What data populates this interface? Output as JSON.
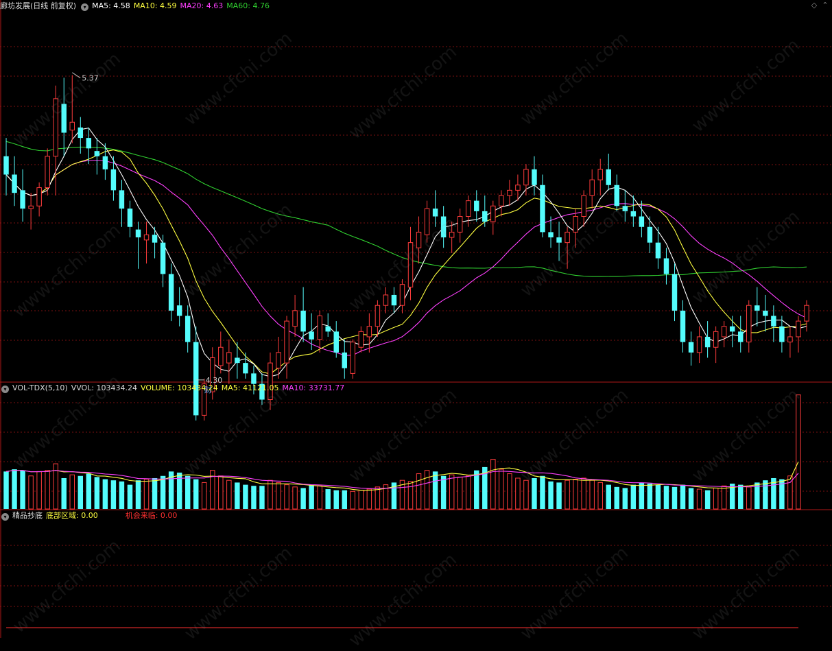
{
  "header_main": {
    "title": "廊坊发展(日线 前复权)",
    "ma5": "MA5: 4.58",
    "ma10": "MA10: 4.59",
    "ma20": "MA20: 4.63",
    "ma60": "MA60: 4.76"
  },
  "header_vol": {
    "name": "VOL-TDX(5,10)",
    "vvol": "VVOL: 103434.24",
    "volume": "VOLUME: 103434.24",
    "ma5": "MA5: 41121.05",
    "ma10": "MA10: 33731.77"
  },
  "header_ind": {
    "name": "精品抄底",
    "bottom": "底部区域: 0.00",
    "chance": "机会来临: 0.00"
  },
  "annotations": {
    "high": "5.37",
    "low": "4.30",
    "fin": "财"
  },
  "watermark": "www.cfchi.com",
  "colors": {
    "up": "#ff3c3c",
    "down": "#54fcfc",
    "ma5": "#ffffff",
    "ma10": "#ffff40",
    "ma20": "#ff40ff",
    "ma60": "#30d030",
    "grid": "#7a1010",
    "divider": "#b01818"
  },
  "chart_data": [
    {
      "type": "candlestick",
      "title": "廊坊发展(日线 前复权)",
      "ylim": [
        4.2,
        5.6
      ],
      "high_marker": 5.37,
      "low_marker": 4.3,
      "ohlc": [
        [
          5.05,
          5.12,
          4.9,
          4.98
        ],
        [
          4.98,
          5.05,
          4.86,
          4.91
        ],
        [
          4.92,
          5.0,
          4.8,
          4.85
        ],
        [
          4.85,
          4.91,
          4.77,
          4.86
        ],
        [
          4.86,
          4.95,
          4.82,
          4.93
        ],
        [
          4.93,
          5.08,
          4.9,
          5.05
        ],
        [
          5.05,
          5.32,
          4.9,
          5.27
        ],
        [
          5.25,
          5.35,
          5.05,
          5.14
        ],
        [
          5.15,
          5.36,
          5.1,
          5.18
        ],
        [
          5.16,
          5.2,
          5.06,
          5.12
        ],
        [
          5.12,
          5.16,
          5.02,
          5.08
        ],
        [
          5.07,
          5.12,
          4.98,
          5.05
        ],
        [
          5.05,
          5.1,
          4.96,
          5.0
        ],
        [
          5.0,
          5.05,
          4.88,
          4.92
        ],
        [
          4.92,
          4.96,
          4.78,
          4.85
        ],
        [
          4.85,
          4.88,
          4.74,
          4.78
        ],
        [
          4.77,
          4.8,
          4.62,
          4.74
        ],
        [
          4.73,
          4.8,
          4.64,
          4.75
        ],
        [
          4.75,
          4.78,
          4.66,
          4.72
        ],
        [
          4.72,
          4.75,
          4.55,
          4.6
        ],
        [
          4.6,
          4.64,
          4.42,
          4.46
        ],
        [
          4.48,
          4.55,
          4.4,
          4.44
        ],
        [
          4.44,
          4.48,
          4.3,
          4.34
        ],
        [
          4.34,
          4.4,
          4.04,
          4.06
        ],
        [
          4.06,
          4.2,
          4.04,
          4.18
        ],
        [
          4.15,
          4.32,
          4.12,
          4.28
        ],
        [
          4.25,
          4.38,
          4.22,
          4.32
        ],
        [
          4.26,
          4.35,
          4.18,
          4.3
        ],
        [
          4.28,
          4.34,
          4.2,
          4.26
        ],
        [
          4.26,
          4.3,
          4.2,
          4.22
        ],
        [
          4.22,
          4.25,
          4.14,
          4.18
        ],
        [
          4.18,
          4.22,
          4.1,
          4.12
        ],
        [
          4.12,
          4.3,
          4.08,
          4.26
        ],
        [
          4.24,
          4.36,
          4.2,
          4.3
        ],
        [
          4.26,
          4.44,
          4.2,
          4.42
        ],
        [
          4.4,
          4.52,
          4.36,
          4.46
        ],
        [
          4.46,
          4.55,
          4.34,
          4.38
        ],
        [
          4.38,
          4.45,
          4.31,
          4.35
        ],
        [
          4.35,
          4.46,
          4.3,
          4.44
        ],
        [
          4.4,
          4.45,
          4.36,
          4.38
        ],
        [
          4.38,
          4.42,
          4.28,
          4.3
        ],
        [
          4.3,
          4.35,
          4.2,
          4.24
        ],
        [
          4.22,
          4.35,
          4.2,
          4.34
        ],
        [
          4.32,
          4.4,
          4.3,
          4.38
        ],
        [
          4.36,
          4.45,
          4.3,
          4.4
        ],
        [
          4.4,
          4.5,
          4.36,
          4.48
        ],
        [
          4.48,
          4.55,
          4.45,
          4.52
        ],
        [
          4.52,
          4.55,
          4.45,
          4.48
        ],
        [
          4.48,
          4.58,
          4.45,
          4.56
        ],
        [
          4.55,
          4.78,
          4.5,
          4.72
        ],
        [
          4.7,
          4.82,
          4.64,
          4.76
        ],
        [
          4.75,
          4.88,
          4.72,
          4.85
        ],
        [
          4.85,
          4.92,
          4.78,
          4.82
        ],
        [
          4.82,
          4.86,
          4.7,
          4.74
        ],
        [
          4.74,
          4.8,
          4.68,
          4.76
        ],
        [
          4.76,
          4.85,
          4.72,
          4.82
        ],
        [
          4.82,
          4.9,
          4.78,
          4.88
        ],
        [
          4.88,
          4.92,
          4.8,
          4.84
        ],
        [
          4.84,
          4.9,
          4.78,
          4.8
        ],
        [
          4.8,
          4.88,
          4.75,
          4.86
        ],
        [
          4.86,
          4.92,
          4.82,
          4.9
        ],
        [
          4.9,
          4.96,
          4.86,
          4.92
        ],
        [
          4.92,
          4.98,
          4.88,
          4.94
        ],
        [
          4.94,
          5.02,
          4.9,
          5.0
        ],
        [
          5.0,
          5.05,
          4.9,
          4.94
        ],
        [
          4.94,
          4.98,
          4.74,
          4.76
        ],
        [
          4.76,
          4.82,
          4.7,
          4.74
        ],
        [
          4.74,
          4.8,
          4.65,
          4.72
        ],
        [
          4.72,
          4.78,
          4.62,
          4.76
        ],
        [
          4.76,
          4.85,
          4.7,
          4.82
        ],
        [
          4.82,
          4.92,
          4.78,
          4.9
        ],
        [
          4.9,
          5.0,
          4.85,
          4.96
        ],
        [
          4.96,
          5.04,
          4.9,
          5.0
        ],
        [
          5.0,
          5.06,
          4.92,
          4.94
        ],
        [
          4.94,
          4.98,
          4.84,
          4.86
        ],
        [
          4.86,
          4.92,
          4.8,
          4.84
        ],
        [
          4.84,
          4.9,
          4.78,
          4.82
        ],
        [
          4.82,
          4.88,
          4.74,
          4.78
        ],
        [
          4.78,
          4.82,
          4.68,
          4.72
        ],
        [
          4.72,
          4.78,
          4.62,
          4.66
        ],
        [
          4.66,
          4.7,
          4.56,
          4.6
        ],
        [
          4.6,
          4.64,
          4.42,
          4.46
        ],
        [
          4.46,
          4.5,
          4.3,
          4.34
        ],
        [
          4.34,
          4.38,
          4.25,
          4.3
        ],
        [
          4.3,
          4.4,
          4.26,
          4.36
        ],
        [
          4.36,
          4.42,
          4.28,
          4.32
        ],
        [
          4.32,
          4.4,
          4.26,
          4.38
        ],
        [
          4.36,
          4.42,
          4.32,
          4.4
        ],
        [
          4.4,
          4.44,
          4.32,
          4.38
        ],
        [
          4.38,
          4.44,
          4.3,
          4.34
        ],
        [
          4.34,
          4.5,
          4.3,
          4.48
        ],
        [
          4.48,
          4.55,
          4.4,
          4.46
        ],
        [
          4.46,
          4.52,
          4.38,
          4.44
        ],
        [
          4.44,
          4.48,
          4.34,
          4.4
        ],
        [
          4.4,
          4.44,
          4.3,
          4.34
        ],
        [
          4.34,
          4.4,
          4.28,
          4.36
        ],
        [
          4.36,
          4.44,
          4.3,
          4.42
        ],
        [
          4.42,
          4.5,
          4.38,
          4.48
        ]
      ]
    },
    {
      "type": "bar",
      "title": "VOL-TDX(5,10)",
      "values": [
        34000,
        36000,
        35000,
        30000,
        34000,
        35000,
        41000,
        28000,
        31000,
        30000,
        32000,
        29000,
        27000,
        26000,
        25000,
        22000,
        26000,
        27000,
        28000,
        30000,
        34000,
        33000,
        30000,
        27000,
        24000,
        35000,
        30000,
        26000,
        24000,
        22000,
        21000,
        21000,
        26000,
        24000,
        22000,
        20000,
        19000,
        22000,
        21000,
        18000,
        17000,
        17000,
        16000,
        17000,
        18000,
        20000,
        22000,
        24000,
        26000,
        25000,
        32000,
        35000,
        34000,
        30000,
        31000,
        29000,
        30000,
        35000,
        38000,
        45000,
        36000,
        32000,
        28000,
        26000,
        28000,
        30000,
        25000,
        24000,
        26000,
        27000,
        28000,
        26000,
        24000,
        22000,
        20000,
        19000,
        22000,
        24000,
        23000,
        22000,
        21000,
        20000,
        22000,
        19000,
        18000,
        17000,
        19000,
        21000,
        23000,
        22000,
        20000,
        24000,
        26000,
        28000,
        27000,
        30000,
        103434
      ]
    },
    {
      "type": "line",
      "title": "精品抄底",
      "series": [
        {
          "name": "底部区域",
          "values": [
            0,
            0,
            0,
            0,
            0,
            0,
            0,
            0,
            0,
            0,
            0,
            0,
            0,
            0,
            0,
            0,
            0,
            0,
            0,
            0,
            0,
            0,
            0,
            0,
            0,
            0,
            0,
            0,
            0,
            0,
            0,
            0,
            0,
            0,
            0,
            0,
            0,
            0,
            0,
            0,
            0,
            0,
            0,
            0,
            0,
            0,
            0,
            0,
            0,
            0,
            0,
            0,
            0,
            0,
            0,
            0,
            0,
            0,
            0,
            0,
            0,
            0,
            0,
            0,
            0,
            0,
            0,
            0,
            0,
            0,
            0,
            0,
            0,
            0,
            0,
            0,
            0,
            0,
            0,
            0,
            0,
            0,
            0,
            0,
            0,
            0,
            0,
            0,
            0,
            0,
            0,
            0,
            0,
            0,
            0,
            0,
            0
          ]
        },
        {
          "name": "机会来临",
          "values": [
            0,
            0,
            0,
            0,
            0,
            0,
            0,
            0,
            0,
            0,
            0,
            0,
            0,
            0,
            0,
            0,
            0,
            0,
            0,
            0,
            0,
            0,
            0,
            0,
            0,
            0,
            0,
            0,
            0,
            0,
            0,
            0,
            0,
            0,
            0,
            0,
            0,
            0,
            0,
            0,
            0,
            0,
            0,
            0,
            0,
            0,
            0,
            0,
            0,
            0,
            0,
            0,
            0,
            0,
            0,
            0,
            0,
            0,
            0,
            0,
            0,
            0,
            0,
            0,
            0,
            0,
            0,
            0,
            0,
            0,
            0,
            0,
            0,
            0,
            0,
            0,
            0,
            0,
            0,
            0,
            0,
            0,
            0,
            0,
            0,
            0,
            0,
            0,
            0,
            0,
            0,
            0,
            0,
            0,
            0,
            0,
            0
          ]
        }
      ]
    }
  ]
}
